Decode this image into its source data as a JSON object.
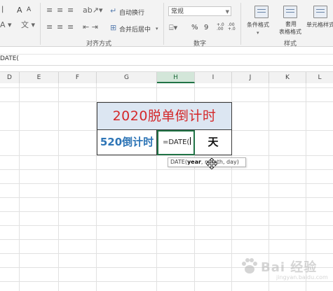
{
  "ribbon": {
    "font_increase": "A",
    "font_decrease": "A",
    "wrap_text": "自动换行",
    "merge_center": "合并后居中",
    "number_format": "常规",
    "percent": "%",
    "comma": "9",
    "decimal_increase": "+.0 .00",
    "decimal_decrease": ".00 +.0",
    "conditional_format": "条件格式",
    "format_table_line1": "套用",
    "format_table_line2": "表格格式",
    "cell_styles": "单元格样式",
    "group_alignment": "对齐方式",
    "group_number": "数字",
    "group_styles": "样式"
  },
  "formula_bar": {
    "content": "DATE("
  },
  "columns": [
    "D",
    "E",
    "F",
    "G",
    "H",
    "I",
    "J",
    "K",
    "L"
  ],
  "active_column": "H",
  "sheet": {
    "title": "2020脱单倒计时",
    "label": "520倒计时",
    "formula": "=DATE(",
    "unit": "天"
  },
  "tooltip": {
    "function": "DATE(",
    "arg_current": "year",
    "rest": ", month, day)"
  },
  "watermark": {
    "brand": "Bai 经验",
    "url": "jingyan.baidu.com"
  },
  "colors": {
    "title_text": "#d4282a",
    "title_fill": "#dce6f2",
    "label_text": "#2e75b6",
    "active_border": "#217346"
  }
}
